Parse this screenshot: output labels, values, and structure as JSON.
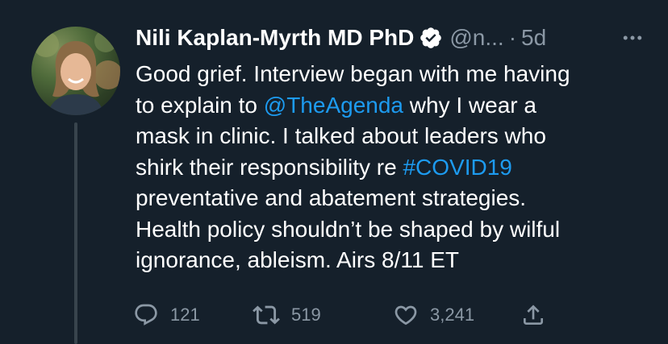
{
  "author": {
    "display_name": "Nili Kaplan-Myrth MD PhD",
    "handle": "@n...",
    "separator": "·",
    "time": "5d",
    "verified": true
  },
  "tweet": {
    "lines": [
      [
        {
          "text": "Good grief. Interview began with me having",
          "link": false
        }
      ],
      [
        {
          "text": "to explain to ",
          "link": false
        },
        {
          "text": "@TheAgenda",
          "link": true
        },
        {
          "text": " why I wear a",
          "link": false
        }
      ],
      [
        {
          "text": "mask in clinic. I talked about leaders who",
          "link": false
        }
      ],
      [
        {
          "text": "shirk their responsibility re ",
          "link": false
        },
        {
          "text": "#COVID19",
          "link": true
        }
      ],
      [
        {
          "text": "preventative and abatement strategies.",
          "link": false
        }
      ],
      [
        {
          "text": "Health policy shouldn’t be shaped by wilful",
          "link": false
        }
      ],
      [
        {
          "text": "ignorance, ableism. Airs 8/11 ET",
          "link": false
        }
      ]
    ]
  },
  "actions": {
    "reply_count": "121",
    "retweet_count": "519",
    "like_count": "3,241"
  },
  "icons": {
    "more": "more-horizontal-icon",
    "verified": "verified-badge-icon",
    "reply": "reply-icon",
    "retweet": "retweet-icon",
    "like": "heart-icon",
    "share": "share-icon"
  },
  "colors": {
    "background": "#15202b",
    "text": "#ffffff",
    "secondary": "#8b98a5",
    "link": "#1d9bf0",
    "thread_line": "#38444d"
  }
}
